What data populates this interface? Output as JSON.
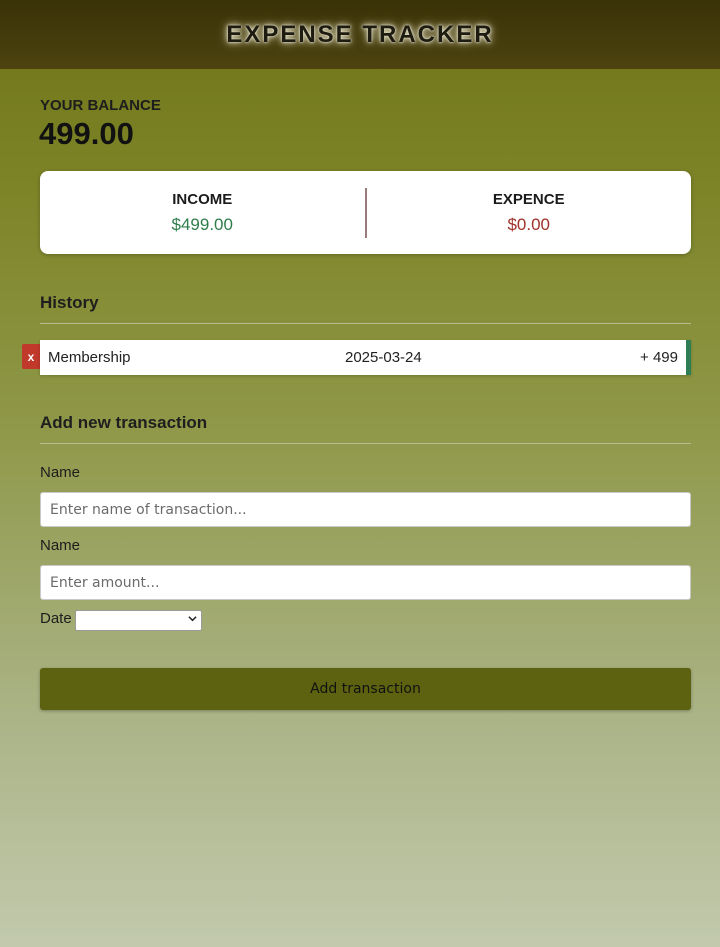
{
  "header": {
    "title": "EXPENSE TRACKER"
  },
  "balance": {
    "label": "YOUR BALANCE",
    "value": "499.00"
  },
  "summary": {
    "income_label": "INCOME",
    "income_value": "$499.00",
    "expense_label": "EXPENCE",
    "expense_value": "$0.00"
  },
  "history": {
    "title": "History",
    "items": [
      {
        "delete_label": "x",
        "name": "Membership",
        "date": "2025-03-24",
        "amount": "+ 499"
      }
    ]
  },
  "form": {
    "title": "Add new transaction",
    "name_label": "Name",
    "name_placeholder": "Enter name of transaction...",
    "amount_label": "Name",
    "amount_placeholder": "Enter amount...",
    "date_label": "Date",
    "date_value": "",
    "submit_label": "Add transaction"
  },
  "colors": {
    "income": "#2e7d4a",
    "expense": "#a0302a",
    "button": "#5c6210",
    "delete": "#c0392b"
  },
  "icons": {
    "select_chevron": "chevron-down-icon"
  }
}
